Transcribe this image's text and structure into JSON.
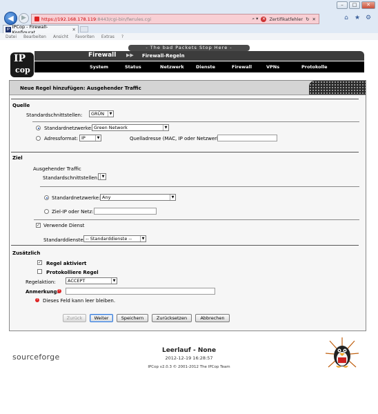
{
  "browser": {
    "url_host": "https://192.168.178.119",
    "url_path": ":8443/cgi-bin/fwrules.cgi",
    "cert_error": "Zertifikatfehler",
    "tab_title": "IPCop - Firewall-Konfigurat...",
    "menu": [
      "Datei",
      "Bearbeiten",
      "Ansicht",
      "Favoriten",
      "Extras",
      "?"
    ]
  },
  "header": {
    "slogan": "- The bad Packets Stop Here -",
    "logo_top": "IP",
    "logo_bottom": "cop",
    "section": "Firewall",
    "page": "Firewall-Regeln",
    "nav": [
      "System",
      "Status",
      "Netzwerk",
      "Dienste",
      "Firewall",
      "VPNs",
      "Protokolle"
    ]
  },
  "form": {
    "title": "Neue Regel hinzufügen: Ausgehender Traffic",
    "quelle": {
      "heading": "Quelle",
      "std_if_label": "Standardschnittstellen:",
      "std_if_value": "GRÜN",
      "std_net_label": "Standardnetzwerke:",
      "std_net_value": "Green Network",
      "addr_label": "Adressformat:",
      "addr_value": "IP",
      "src_addr_label": "Quelladresse (MAC, IP oder Netzwerk):"
    },
    "ziel": {
      "heading": "Ziel",
      "sub": "Ausgehender Traffic",
      "std_if_label": "Standardschnittstellen:",
      "std_net_label": "Standardnetzwerke:",
      "std_net_value": "Any",
      "dest_label": "Ziel-IP oder Netz:",
      "use_service_label": "Verwende Dienst",
      "std_services_label": "Standarddienste:",
      "std_services_value": "-- Standarddienste --"
    },
    "extra": {
      "heading": "Zusätzlich",
      "active_label": "Regel aktiviert",
      "log_label": "Protokolliere Regel",
      "action_label": "Regelaktion:",
      "action_value": "ACCEPT",
      "remark_label": "Anmerkung:",
      "required_note": "Dieses Feld kann leer bleiben."
    },
    "buttons": {
      "back": "Zurück",
      "next": "Weiter",
      "save": "Speichern",
      "reset": "Zurücksetzen",
      "cancel": "Abbrechen"
    }
  },
  "footer": {
    "sourceforge": "sourceforge",
    "status": "Leerlauf - None",
    "timestamp": "2012-12-19 16:28:57",
    "copyright": "IPCop v2.0.3 © 2001-2012 The IPCop Team"
  }
}
